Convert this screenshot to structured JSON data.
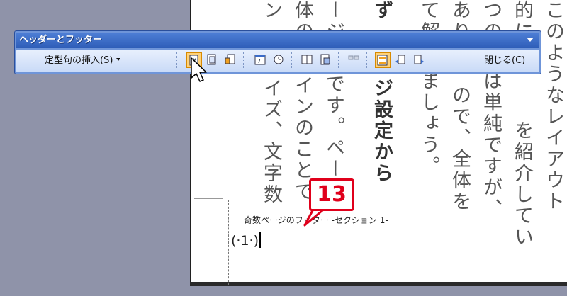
{
  "document": {
    "columns": [
      "このようなレイアウト",
      "的に",
      "つの",
      "あり",
      "て解",
      "ず",
      "ージ",
      "体の",
      "ン",
      "",
      "を紹介してい",
      "は単純ですが、",
      "ので、全体を",
      "ましょう。",
      "ージ設定から",
      "です。ペー",
      "インのことで",
      "イズ、文字数"
    ],
    "footer_label": "奇数ページのフッター -セクション 1-",
    "page_number": "(·1·)"
  },
  "callout": {
    "label": "13"
  },
  "toolbar": {
    "title": "ヘッダーとフッター",
    "insert_label": "定型句の挿入(S)",
    "close_label": "閉じる(C)",
    "buttons": [
      {
        "icon": "page-number-icon",
        "active": true
      },
      {
        "icon": "page-count-icon",
        "active": false
      },
      {
        "icon": "format-page-number-icon",
        "active": false
      },
      {
        "icon": "date-icon",
        "active": false
      },
      {
        "icon": "time-icon",
        "active": false
      },
      {
        "icon": "page-setup-icon",
        "active": false
      },
      {
        "icon": "show-document-text-icon",
        "active": false
      },
      {
        "icon": "same-as-previous-icon",
        "active": false
      },
      {
        "icon": "switch-header-footer-icon",
        "active": true
      },
      {
        "icon": "show-previous-icon",
        "active": false
      },
      {
        "icon": "show-next-icon",
        "active": false
      }
    ],
    "colors": {
      "title_bar": "#2e5db8",
      "body": "#c9daf7",
      "active": "#ffd27a"
    }
  }
}
